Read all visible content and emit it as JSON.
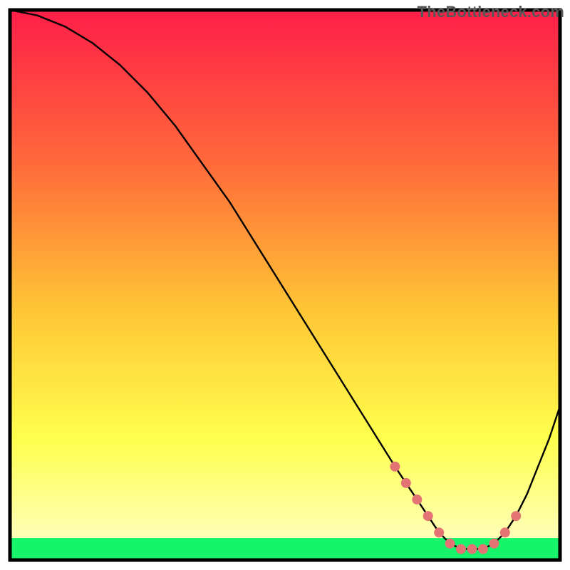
{
  "watermark": "TheBottleneck.com",
  "colors": {
    "gradient_top": "#ff1e49",
    "gradient_mid1": "#ff6a3a",
    "gradient_mid2": "#ffc735",
    "gradient_mid3": "#ffff4d",
    "gradient_bottom": "#ffffcf",
    "green_band": "#14f56a",
    "curve": "#000000",
    "dots": "#e37473",
    "border": "#000000"
  },
  "chart_data": {
    "type": "line",
    "title": "",
    "xlabel": "",
    "ylabel": "",
    "xlim": [
      0,
      100
    ],
    "ylim": [
      0,
      100
    ],
    "grid": false,
    "legend": false,
    "series": [
      {
        "name": "bottleneck-curve",
        "x": [
          0,
          5,
          10,
          15,
          20,
          25,
          30,
          35,
          40,
          45,
          50,
          55,
          60,
          65,
          70,
          72,
          74,
          76,
          78,
          80,
          82,
          84,
          86,
          88,
          90,
          92,
          94,
          96,
          98,
          100
        ],
        "y": [
          100,
          99,
          97,
          94,
          90,
          85,
          79,
          72,
          65,
          57,
          49,
          41,
          33,
          25,
          17,
          14,
          11,
          8,
          5,
          3,
          2,
          2,
          2,
          3,
          5,
          8,
          12,
          17,
          22,
          28
        ]
      }
    ],
    "highlight_dots": {
      "name": "recommended-range",
      "x": [
        70,
        72,
        74,
        76,
        78,
        80,
        82,
        84,
        86,
        88,
        90,
        92
      ],
      "y": [
        17,
        14,
        11,
        8,
        5,
        3,
        2,
        2,
        2,
        3,
        5,
        8
      ]
    },
    "green_band_y": [
      0,
      4
    ]
  }
}
